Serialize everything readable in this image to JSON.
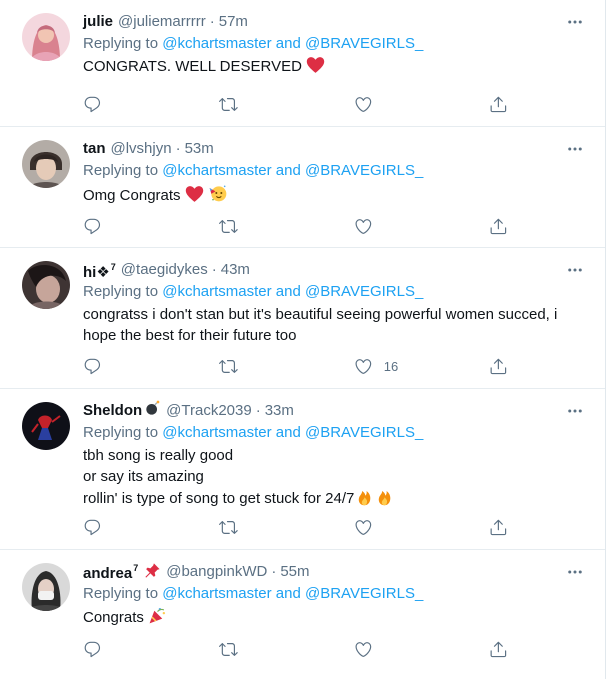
{
  "tweets": [
    {
      "name": "julie",
      "name_sup": "",
      "handle": "@juliemarrrrr",
      "time": "57m",
      "reply_prefix": "Replying to",
      "reply_targets": "@kchartsmaster and @BRAVEGIRLS_",
      "lines": [
        "CONGRATS. WELL DESERVED"
      ],
      "like_count": "",
      "avatar_color": "#e8a3b6"
    },
    {
      "name": "tan",
      "name_sup": "",
      "handle": "@lvshjyn",
      "time": "53m",
      "reply_prefix": "Replying to",
      "reply_targets": "@kchartsmaster and @BRAVEGIRLS_",
      "lines": [
        "Omg Congrats"
      ],
      "like_count": "",
      "avatar_color": "#8a7d76"
    },
    {
      "name": "hi❖",
      "name_sup": "7",
      "handle": "@taegidykes",
      "time": "43m",
      "reply_prefix": "Replying to",
      "reply_targets": "@kchartsmaster and @BRAVEGIRLS_",
      "lines": [
        "congratss i don't stan but it's beautiful seeing powerful women succed, i",
        "hope the best for their future too"
      ],
      "like_count": "16",
      "avatar_color": "#5a4a48"
    },
    {
      "name": "Sheldon",
      "name_sup": "",
      "handle": "@Track2039",
      "time": "33m",
      "reply_prefix": "Replying to",
      "reply_targets": "@kchartsmaster and @BRAVEGIRLS_",
      "lines": [
        "tbh song is really good",
        "or say its amazing",
        "rollin' is type of song to get stuck for 24/7"
      ],
      "like_count": "",
      "avatar_color": "#15151c"
    },
    {
      "name": "andrea",
      "name_sup": "7",
      "handle": "@bangpinkWD",
      "time": "55m",
      "reply_prefix": "Replying to",
      "reply_targets": "@kchartsmaster and @BRAVEGIRLS_",
      "lines": [
        "Congrats"
      ],
      "like_count": "",
      "avatar_color": "#9a9a9a"
    }
  ],
  "separator": "·",
  "colors": {
    "accent": "#1da1f2",
    "secondary_text": "#5b7083",
    "primary_text": "#0f1419",
    "heart_red": "#e0245e",
    "divider": "#e6ecf0"
  },
  "icons": {
    "more": "more-icon",
    "reply": "reply-icon",
    "retweet": "retweet-icon",
    "like": "like-icon",
    "share": "share-icon",
    "inline": [
      "red-heart-emoji",
      "party-face-emoji",
      "bomb-emoji",
      "fire-emoji",
      "pushpin-emoji",
      "party-popper-emoji"
    ]
  }
}
